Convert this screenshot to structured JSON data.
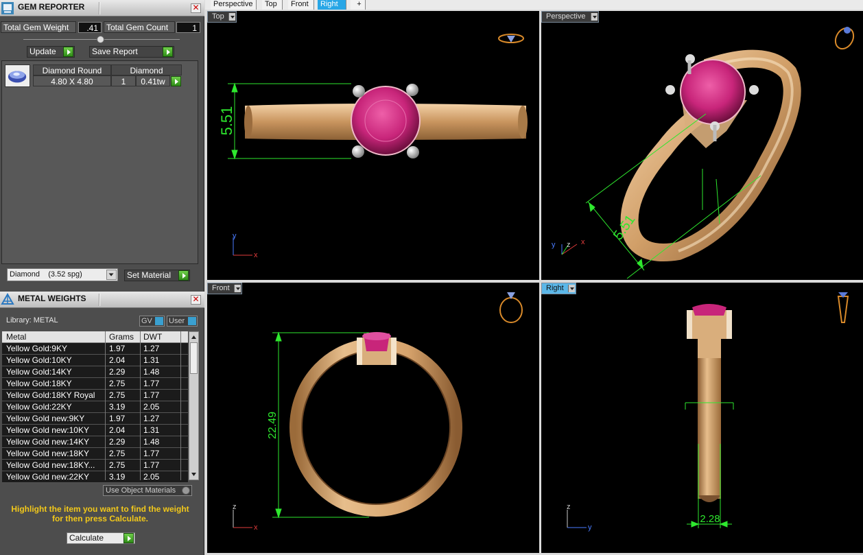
{
  "gem_reporter": {
    "title": "GEM REPORTER",
    "total_weight_label": "Total Gem Weight",
    "total_weight_value": ".41",
    "total_count_label": "Total Gem Count",
    "total_count_value": "1",
    "update_label": "Update",
    "save_report_label": "Save Report",
    "gem": {
      "name": "Diamond Round",
      "type": "Diamond",
      "size": "4.80 X 4.80",
      "qty": "1",
      "weight": "0.41tw"
    },
    "material_select": "Diamond    (3.52 spg)",
    "set_material_label": "Set Material"
  },
  "metal_weights": {
    "title": "METAL WEIGHTS",
    "library": "Library: METAL",
    "gv": "GV",
    "user": "User",
    "headers": [
      "Metal",
      "Grams",
      "DWT"
    ],
    "rows": [
      [
        "Yellow Gold:9KY",
        "1.97",
        "1.27"
      ],
      [
        "Yellow Gold:10KY",
        "2.04",
        "1.31"
      ],
      [
        "Yellow Gold:14KY",
        "2.29",
        "1.48"
      ],
      [
        "Yellow Gold:18KY",
        "2.75",
        "1.77"
      ],
      [
        "Yellow Gold:18KY Royal",
        "2.75",
        "1.77"
      ],
      [
        "Yellow Gold:22KY",
        "3.19",
        "2.05"
      ],
      [
        "Yellow Gold new:9KY",
        "1.97",
        "1.27"
      ],
      [
        "Yellow Gold new:10KY",
        "2.04",
        "1.31"
      ],
      [
        "Yellow Gold new:14KY",
        "2.29",
        "1.48"
      ],
      [
        "Yellow Gold new:18KY",
        "2.75",
        "1.77"
      ],
      [
        "Yellow Gold new:18KY...",
        "2.75",
        "1.77"
      ],
      [
        "Yellow Gold new:22KY",
        "3.19",
        "2.05"
      ]
    ],
    "use_object_materials": "Use Object Materials",
    "hint_line1": "Highlight the item you want to find the weight",
    "hint_line2": "for then press Calculate.",
    "calculate_label": "Calculate"
  },
  "tabs": [
    "Perspective",
    "Top",
    "Front",
    "Right",
    "+"
  ],
  "viewports": {
    "top": "Top",
    "perspective": "Perspective",
    "front": "Front",
    "right": "Right"
  },
  "dims": {
    "top": "5.51",
    "perspective": "5.51",
    "front": "22.49",
    "right": "2.28"
  },
  "axes": {
    "x": "x",
    "y": "y",
    "z": "z"
  },
  "colors": {
    "accent": "#28a6e6",
    "gold": "#d9ae7c",
    "ruby": "#c8257a",
    "dim": "#2ee82e",
    "hint": "#f2c81a"
  }
}
